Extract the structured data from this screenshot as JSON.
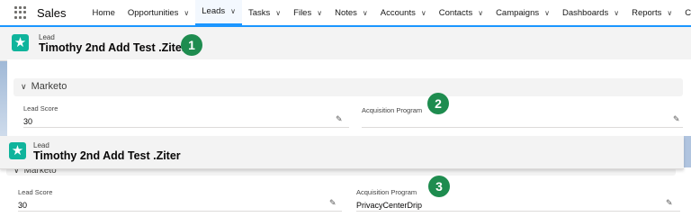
{
  "nav": {
    "app_name": "Sales",
    "items": [
      {
        "label": "Home",
        "chevron": false,
        "active": false
      },
      {
        "label": "Opportunities",
        "chevron": true,
        "active": false
      },
      {
        "label": "Leads",
        "chevron": true,
        "active": true
      },
      {
        "label": "Tasks",
        "chevron": true,
        "active": false
      },
      {
        "label": "Files",
        "chevron": true,
        "active": false
      },
      {
        "label": "Notes",
        "chevron": true,
        "active": false
      },
      {
        "label": "Accounts",
        "chevron": true,
        "active": false
      },
      {
        "label": "Contacts",
        "chevron": true,
        "active": false
      },
      {
        "label": "Campaigns",
        "chevron": true,
        "active": false
      },
      {
        "label": "Dashboards",
        "chevron": true,
        "active": false
      },
      {
        "label": "Reports",
        "chevron": true,
        "active": false
      },
      {
        "label": "Chatter",
        "chevron": false,
        "active": false
      }
    ]
  },
  "record1": {
    "object_label": "Lead",
    "name": "Timothy 2nd Add Test .Ziter",
    "section": "Marketo",
    "fields": {
      "lead_score_label": "Lead Score",
      "lead_score_value": "30",
      "acq_label": "Acquisition Program",
      "acq_value": ""
    }
  },
  "record2": {
    "object_label": "Lead",
    "name": "Timothy 2nd Add Test .Ziter",
    "section": "Marketo",
    "fields": {
      "lead_score_label": "Lead Score",
      "lead_score_value": "30",
      "acq_label": "Acquisition Program",
      "acq_value": "PrivacyCenterDrip"
    }
  },
  "badges": {
    "b1": "1",
    "b2": "2",
    "b3": "3"
  },
  "colors": {
    "accent": "#1b96ff",
    "lead_icon": "#10b49c",
    "badge": "#1e8c4f"
  }
}
